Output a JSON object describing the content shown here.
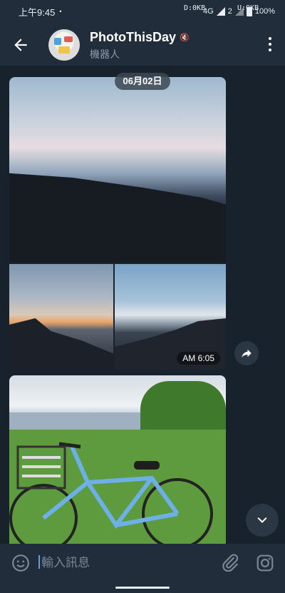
{
  "status_bar": {
    "time": "上午9:45",
    "dot": "•",
    "network": "4G",
    "sim_slot": "2",
    "battery": "100%"
  },
  "net_speed": {
    "download": "D:0KB",
    "upload": "U:0KB"
  },
  "header": {
    "title": "PhotoThisDay",
    "subtitle": "機器人",
    "mute_icon": "🔇"
  },
  "chat": {
    "date_chip": "06月02日",
    "album_timestamp": "AM 6:05"
  },
  "composer": {
    "placeholder": "輸入訊息"
  },
  "colors": {
    "app_bar": "#212d3b",
    "chat_bg": "#18222d",
    "accent": "#5aa0e5"
  },
  "icons": {
    "back": "arrow-left-icon",
    "menu": "more-vert-icon",
    "share": "share-icon",
    "scroll_down": "chevron-down-icon",
    "emoji": "emoji-icon",
    "attach": "paperclip-icon",
    "camera": "instagram-camera-icon"
  }
}
